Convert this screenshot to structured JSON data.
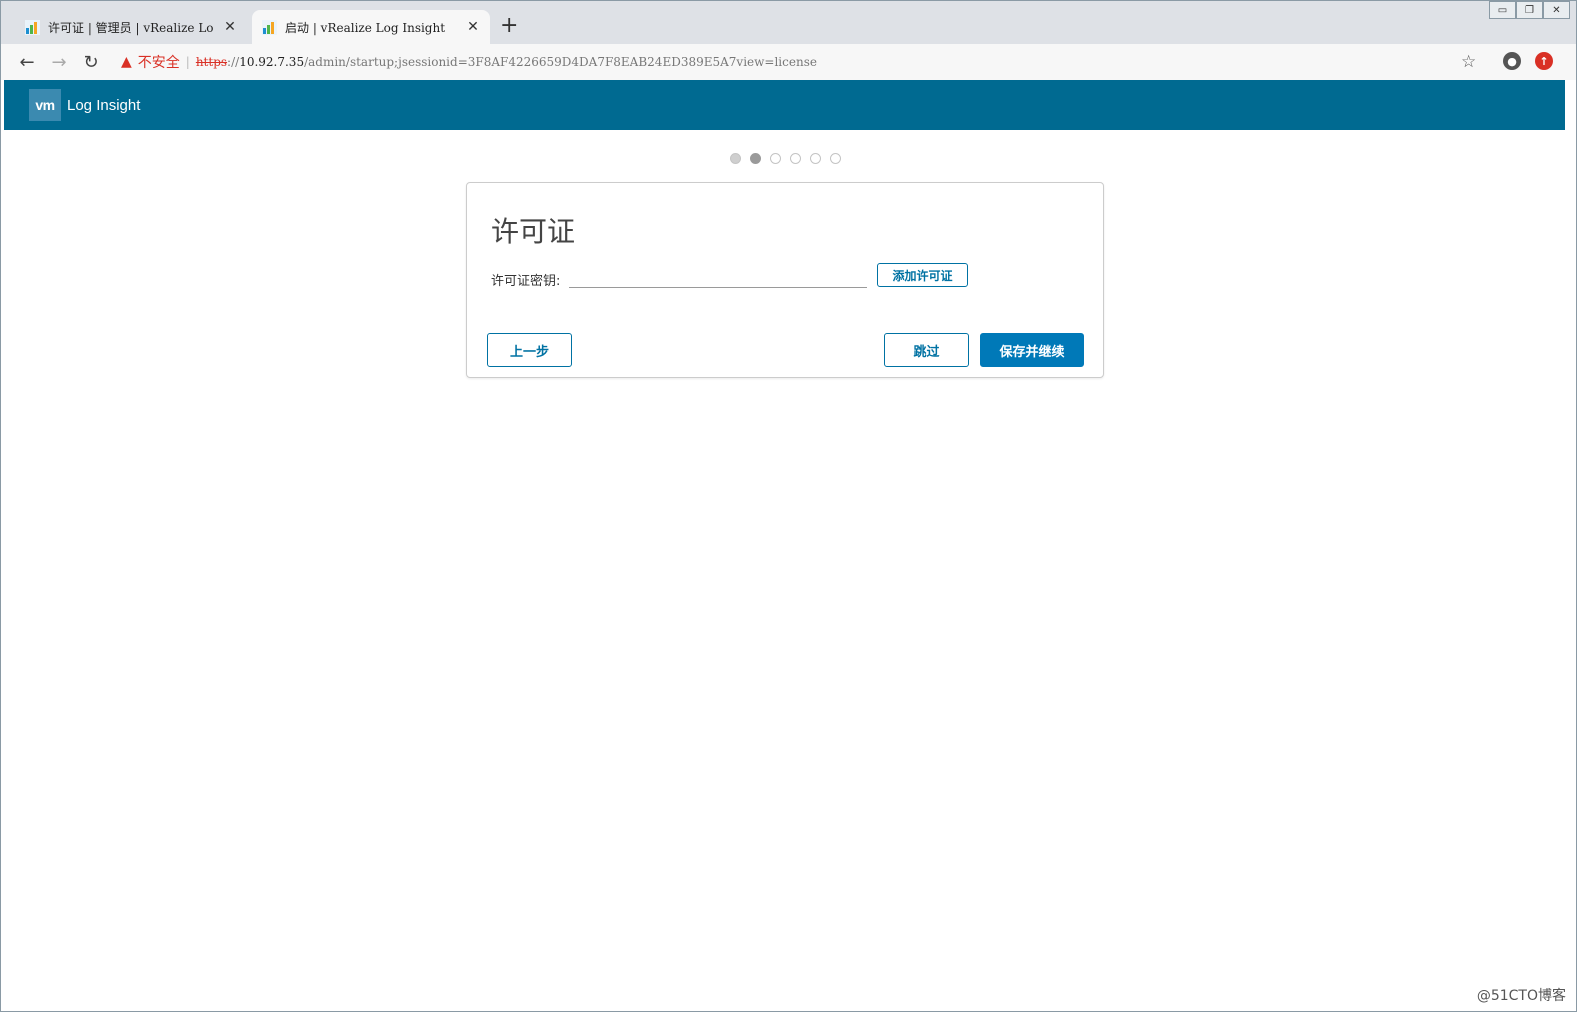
{
  "browser": {
    "tabs": [
      {
        "title": "许可证 | 管理员 | vRealize Lo",
        "close": "✕",
        "active": false
      },
      {
        "title": "启动 | vRealize Log Insight",
        "close": "✕",
        "active": true
      }
    ],
    "new_tab": "+",
    "nav": {
      "back": "←",
      "forward": "→",
      "reload": "↻"
    },
    "security_warning": "不安全",
    "url": {
      "scheme": "https",
      "separator": "://",
      "host": "10.92.7.35",
      "path": "/admin/startup;jsessionid=3F8AF4226659D4DA7F8EAB24ED389E5A7view=license"
    },
    "star": "☆",
    "window_controls": {
      "minimize": "▭",
      "restore": "❐",
      "close": "✕"
    }
  },
  "app": {
    "logo": "vm",
    "product_name": "Log Insight"
  },
  "stepper": {
    "total_steps": 6,
    "current_step": 2
  },
  "license_card": {
    "title": "许可证",
    "key_label": "许可证密钥:",
    "key_value": "",
    "add_button": "添加许可证",
    "back_button": "上一步",
    "skip_button": "跳过",
    "save_button": "保存并继续"
  },
  "watermark": "@51CTO博客",
  "colors": {
    "header_bg": "#006a91",
    "primary_button": "#0079b8",
    "link_blue": "#0072a3",
    "insecure_red": "#d93025"
  }
}
